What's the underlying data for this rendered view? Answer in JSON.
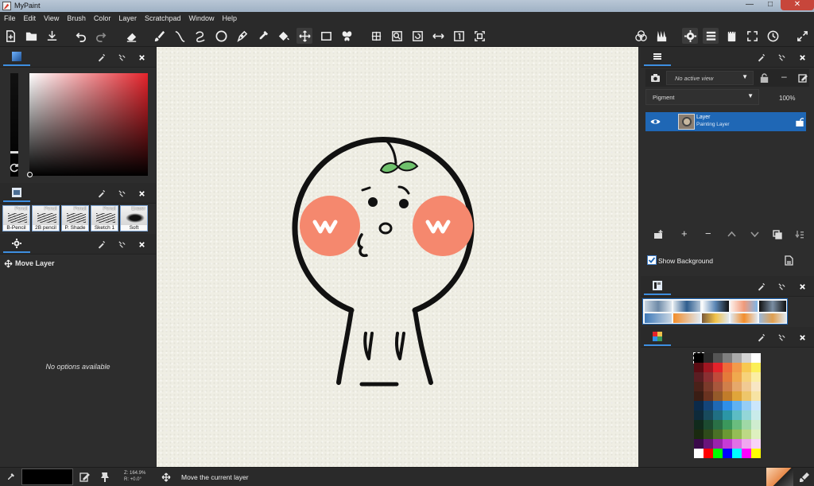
{
  "window": {
    "title": "MyPaint",
    "controls": {
      "minimize": "—",
      "maximize": "□",
      "close": "✕"
    }
  },
  "menu": [
    "File",
    "Edit",
    "View",
    "Brush",
    "Color",
    "Layer",
    "Scratchpad",
    "Window",
    "Help"
  ],
  "toolbar": {
    "left_icons": [
      "new-file-icon",
      "open-file-icon",
      "save-file-icon",
      "undo-icon",
      "redo-icon",
      "eraser-icon",
      "brush-icon",
      "inking-icon",
      "freehand-icon",
      "ellipse-icon",
      "pen-icon",
      "color-picker-icon",
      "fill-icon",
      "move-layer-icon",
      "frame-icon",
      "symmetry-icon"
    ],
    "view_icons": [
      "pan-icon",
      "zoom-icon",
      "rotate-icon",
      "flip-horizontal-icon",
      "reset-view-icon",
      "fit-view-icon"
    ],
    "right_icons": [
      "color-wheel-icon",
      "brushes-icon",
      "settings-icon",
      "layers-menu-icon",
      "scratchpad-icon",
      "fullscreen-icon",
      "history-icon",
      "expand-icon"
    ],
    "active_tool": "move-layer-icon"
  },
  "color_panel": {
    "selected_hue": "#e4232b",
    "reset_icon": "refresh-icon"
  },
  "brush_panel": {
    "brushes": [
      {
        "top_label": "Pencil",
        "bottom_label": "B-Pencil"
      },
      {
        "top_label": "Pencil",
        "bottom_label": "2B pencil"
      },
      {
        "top_label": "Pencil",
        "bottom_label": "P. Shade"
      },
      {
        "top_label": "Pencil",
        "bottom_label": "Sketch 1"
      },
      {
        "top_label": "Eraser",
        "bottom_label": "Soft"
      }
    ]
  },
  "tool_options": {
    "title": "Move Layer",
    "empty_message": "No options available"
  },
  "layers_panel": {
    "view_select": "No active view",
    "blend_mode": "Pigment",
    "opacity": "100%",
    "layers": [
      {
        "name": "Layer",
        "type": "Painting Layer",
        "visible": true,
        "selected": true
      }
    ],
    "show_background_label": "Show Background",
    "show_background_checked": true
  },
  "palette": {
    "colors": [
      [
        "#000000",
        "#2a2a2a",
        "#555555",
        "#7f7f7f",
        "#aaaaaa",
        "#d4d4d4",
        "#ffffff"
      ],
      [
        "#5a0b12",
        "#a01621",
        "#e4232b",
        "#ef6a3a",
        "#f39a4a",
        "#f7c851",
        "#fcef57"
      ],
      [
        "#5a1d22",
        "#8a2f32",
        "#c04a3a",
        "#e47a3a",
        "#f0a94e",
        "#f6d27a",
        "#fbeea3"
      ],
      [
        "#4a2119",
        "#7a3a2a",
        "#a8573c",
        "#d07f4a",
        "#e6a86b",
        "#f1ca93",
        "#f8e6c4"
      ],
      [
        "#3a1d14",
        "#6a3320",
        "#955a2a",
        "#c17c2a",
        "#e0a53a",
        "#eec66a",
        "#f7e3a3"
      ],
      [
        "#0b2a4a",
        "#14457a",
        "#1f69b5",
        "#2f8fe8",
        "#5fb1f2",
        "#95cdf6",
        "#cbe6fb"
      ],
      [
        "#0e2a3a",
        "#184a5c",
        "#206f83",
        "#2b96a6",
        "#5cbcc4",
        "#93d6d8",
        "#c9ebea"
      ],
      [
        "#102a1c",
        "#1c4a30",
        "#2a7046",
        "#3b985c",
        "#6abd7e",
        "#9fd8a6",
        "#cfeccf"
      ],
      [
        "#1a2a10",
        "#2e4a1a",
        "#4a7026",
        "#6b9834",
        "#94bd55",
        "#bdd985",
        "#def0bf"
      ],
      [
        "#3a0a4a",
        "#6a147a",
        "#9a22ac",
        "#c63ad6",
        "#e070e6",
        "#f0a6f0",
        "#f8d3f8"
      ],
      [
        "#ffffff",
        "#ff0000",
        "#00ff00",
        "#0000ff",
        "#00ffff",
        "#ff00ff",
        "#ffff00"
      ]
    ]
  },
  "status": {
    "zoom": "Z: 164.9%",
    "rotation": "R: +0.0°",
    "message": "Move the current layer",
    "current_color": "#000000"
  }
}
